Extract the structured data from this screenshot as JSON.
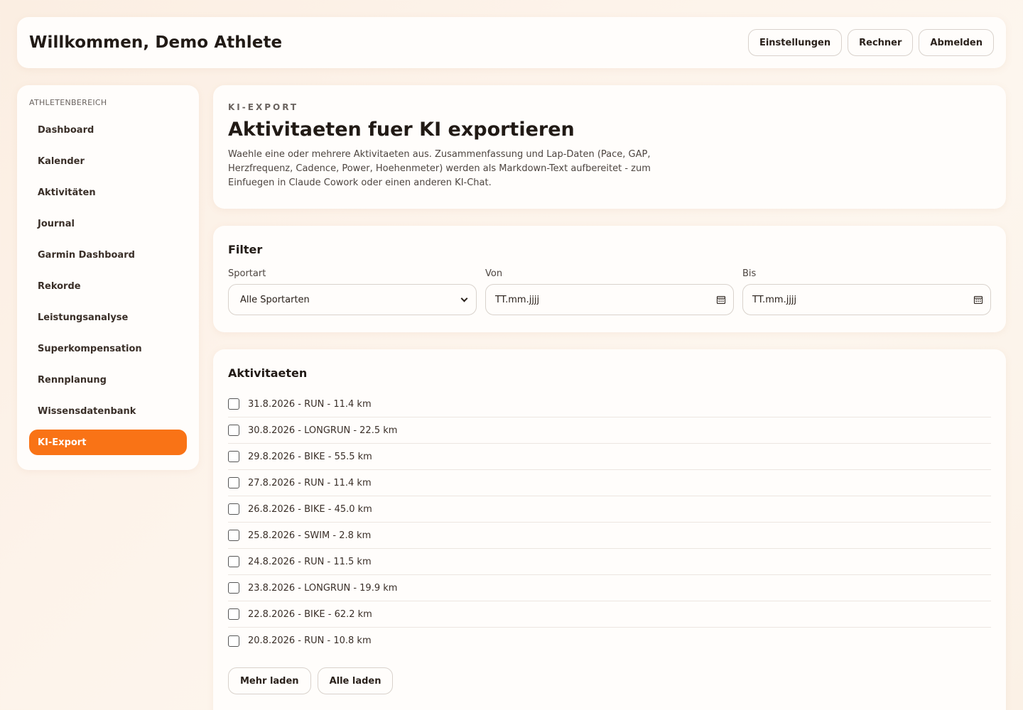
{
  "header": {
    "title": "Willkommen, Demo Athlete",
    "actions": [
      "Einstellungen",
      "Rechner",
      "Abmelden"
    ]
  },
  "sidebar": {
    "heading": "Athletenbereich",
    "items": [
      {
        "label": "Dashboard",
        "active": false
      },
      {
        "label": "Kalender",
        "active": false
      },
      {
        "label": "Aktivitäten",
        "active": false
      },
      {
        "label": "Journal",
        "active": false
      },
      {
        "label": "Garmin Dashboard",
        "active": false
      },
      {
        "label": "Rekorde",
        "active": false
      },
      {
        "label": "Leistungsanalyse",
        "active": false
      },
      {
        "label": "Superkompensation",
        "active": false
      },
      {
        "label": "Rennplanung",
        "active": false
      },
      {
        "label": "Wissensdatenbank",
        "active": false
      },
      {
        "label": "KI-Export",
        "active": true
      }
    ]
  },
  "intro": {
    "eyebrow": "KI-Export",
    "title": "Aktivitaeten fuer KI exportieren",
    "description": "Waehle eine oder mehrere Aktivitaeten aus. Zusammenfassung und Lap-Daten (Pace, GAP, Herzfrequenz, Cadence, Power, Hoehenmeter) werden als Markdown-Text aufbereitet - zum Einfuegen in Claude Cowork oder einen anderen KI-Chat."
  },
  "filter": {
    "title": "Filter",
    "sport": {
      "label": "Sportart",
      "value": "Alle Sportarten"
    },
    "from": {
      "label": "Von",
      "value": "TT.mm.jjjj"
    },
    "to": {
      "label": "Bis",
      "value": "TT.mm.jjjj"
    }
  },
  "activities": {
    "title": "Aktivitaeten",
    "items": [
      "31.8.2026 - RUN - 11.4 km",
      "30.8.2026 - LONGRUN - 22.5 km",
      "29.8.2026 - BIKE - 55.5 km",
      "27.8.2026 - RUN - 11.4 km",
      "26.8.2026 - BIKE - 45.0 km",
      "25.8.2026 - SWIM - 2.8 km",
      "24.8.2026 - RUN - 11.5 km",
      "23.8.2026 - LONGRUN - 19.9 km",
      "22.8.2026 - BIKE - 62.2 km",
      "20.8.2026 - RUN - 10.8 km"
    ],
    "more_label": "Mehr laden",
    "all_label": "Alle laden"
  },
  "colors": {
    "accent": "#f97316"
  }
}
